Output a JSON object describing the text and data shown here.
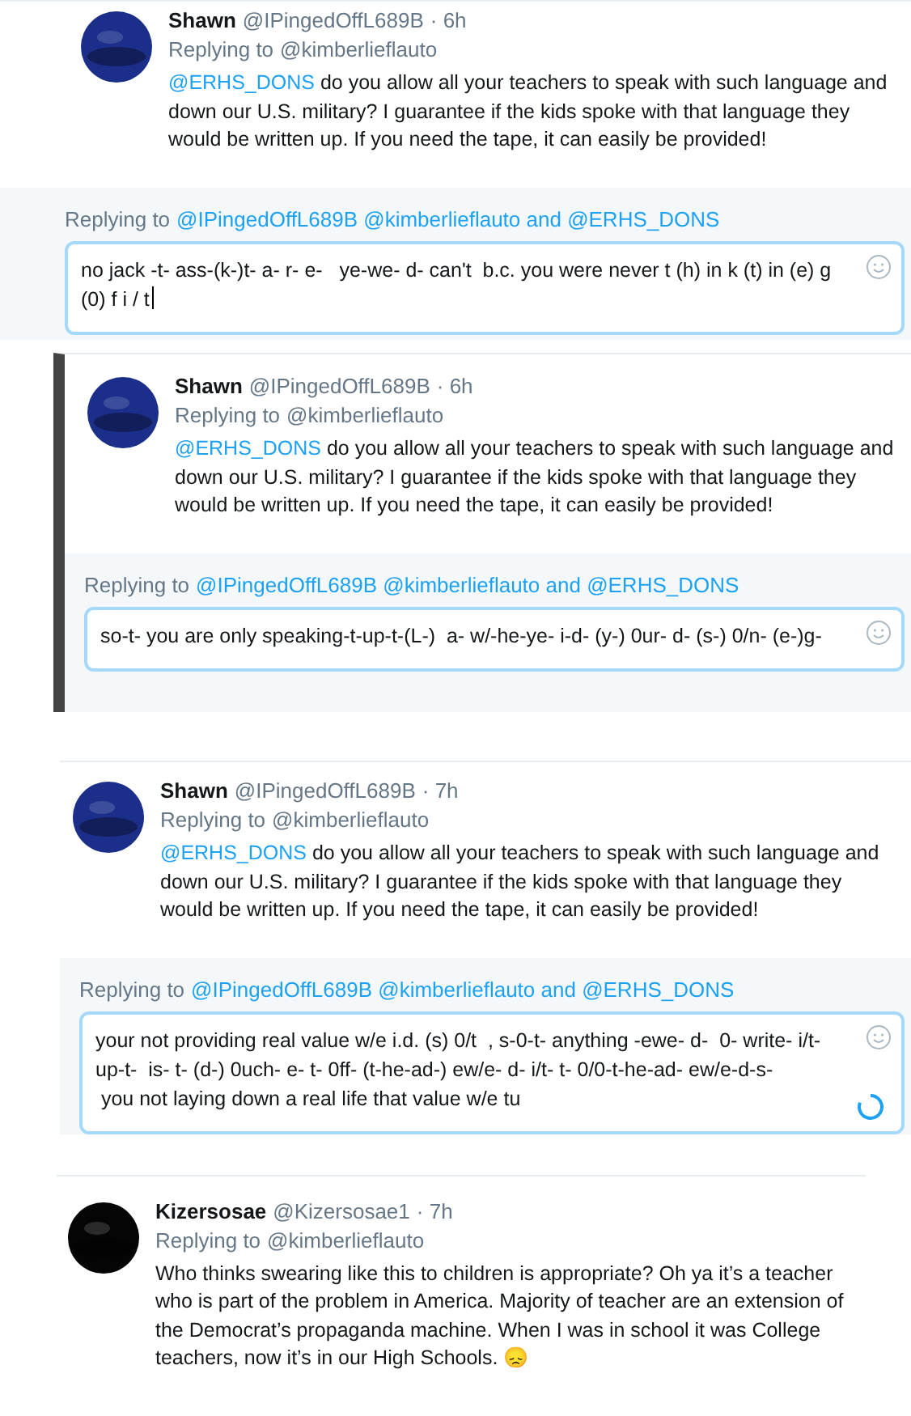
{
  "panels": [
    {
      "kind": "plain",
      "tweet": {
        "name": "Shawn",
        "handle": "@IPingedOffL689B",
        "time": "· 6h",
        "replying": "Replying to",
        "replying_to": "@kimberlieflauto",
        "mention": "@ERHS_DONS",
        "lines": [
          " do you allow all your teachers to speak with such language and",
          "down our U.S. military? I guarantee if the kids spoke with that language they",
          "would be written up. If you need the tape, it can easily be provided!"
        ]
      },
      "reply": {
        "label": "Replying to",
        "to": "@IPingedOffL689B @kimberlieflauto and @ERHS_DONS",
        "lines": [
          "no jack -t- ass-(k-)t- a- r- e-   ye-we- d- can't  b.c. you were never t (h) in k (t) in (e) g",
          "(0) f i / t"
        ],
        "cursor": true,
        "loading": false
      }
    },
    {
      "kind": "barred",
      "tweet": {
        "name": "Shawn",
        "handle": "@IPingedOffL689B",
        "time": "· 6h",
        "replying": "Replying to",
        "replying_to": "@kimberlieflauto",
        "mention": "@ERHS_DONS",
        "lines": [
          " do you allow all your teachers to speak with such language and",
          "down our U.S. military? I guarantee if the kids spoke with that language they",
          "would be written up. If you need the tape, it can easily be provided!"
        ]
      },
      "reply": {
        "label": "Replying to",
        "to": "@IPingedOffL689B @kimberlieflauto and @ERHS_DONS",
        "lines": [
          "so-t- you are only speaking-t-up-t-(L-)  a- w/-he-ye- i-d- (y-) 0ur- d- (s-) 0/n- (e-)g-"
        ],
        "cursor": false,
        "loading": false
      }
    },
    {
      "kind": "plain",
      "tweet": {
        "name": "Shawn",
        "handle": "@IPingedOffL689B",
        "time": "· 7h",
        "replying": "Replying to",
        "replying_to": "@kimberlieflauto",
        "mention": "@ERHS_DONS",
        "lines": [
          " do you allow all your teachers to speak with such language and",
          "down our U.S. military? I guarantee if the kids spoke with that language they",
          "would be written up. If you need the tape, it can easily be provided!"
        ]
      },
      "reply": {
        "label": "Replying to",
        "to": "@IPingedOffL689B @kimberlieflauto and @ERHS_DONS",
        "lines": [
          "your not providing real value w/e i.d. (s) 0/t  , s-0-t- anything -ewe- d-  0- write- i/t-",
          "up-t-  is- t- (d-) 0uch- e- t- 0ff- (t-he-ad-) ew/e- d- i/t- t- 0/0-t-he-ad- ew/e-d-s-",
          " you not laying down a real life that value w/e tu"
        ],
        "cursor": false,
        "loading": true
      }
    }
  ],
  "last_tweet": {
    "name": "Kizersosae",
    "handle": "@Kizersosae1",
    "time": "· 7h",
    "replying": "Replying to",
    "replying_to": "@kimberlieflauto",
    "lines": [
      "Who thinks swearing like this to children is appropriate? Oh ya it’s a teacher",
      "who is part of the problem in America. Majority of teacher are an extension of",
      "the Democrat’s propaganda machine. When I was in school it was College",
      "teachers, now it’s in our High Schools. 😞"
    ]
  }
}
